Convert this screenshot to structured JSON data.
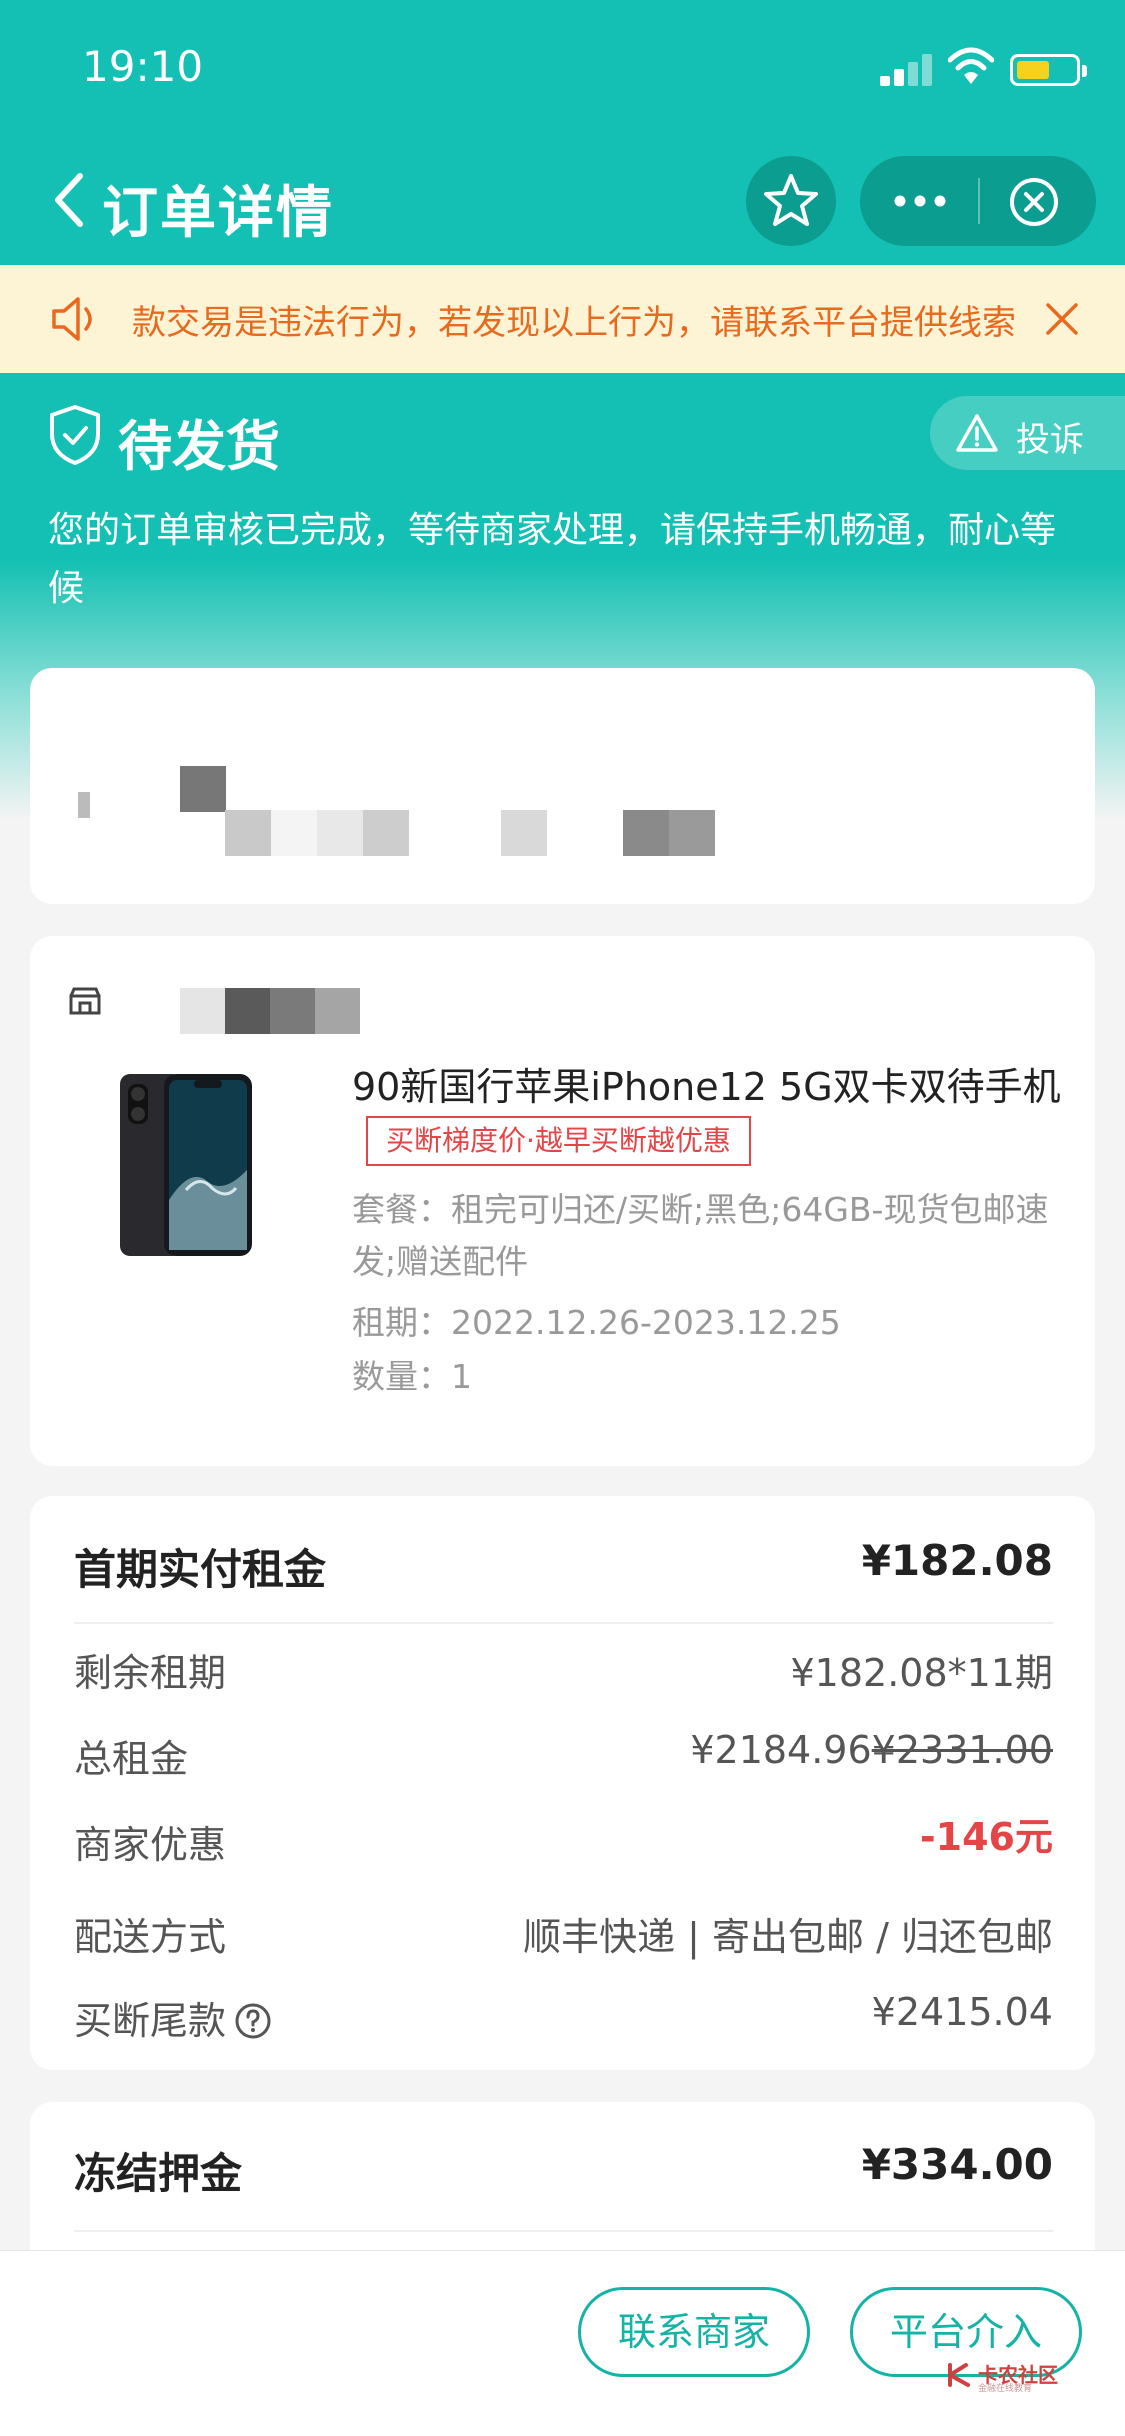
{
  "status_bar": {
    "time": "19:10"
  },
  "nav": {
    "title": "订单详情"
  },
  "notice": {
    "text": "款交易是违法行为，若发现以上行为，请联系平台提供线索"
  },
  "order_status": {
    "title": "待发货",
    "description": "您的订单审核已完成，等待商家处理，请保持手机畅通，耐心等候",
    "complain_label": "投诉"
  },
  "product": {
    "title": "90新国行苹果iPhone12 5G双卡双待手机",
    "promo_tag": "买断梯度价·越早买断越优惠",
    "spec": "套餐：租完可归还/买断;黑色;64GB-现货包邮速发;赠送配件",
    "term": "租期：2022.12.26-2023.12.25",
    "quantity": "数量：1"
  },
  "rent": {
    "first_label": "首期实付租金",
    "first_value": "¥182.08",
    "remaining_label": "剩余租期",
    "remaining_value": "¥182.08*11期",
    "total_label": "总租金",
    "total_value": "¥2184.96",
    "total_original": "¥2331.00",
    "discount_label": "商家优惠",
    "discount_value": "-146元",
    "delivery_label": "配送方式",
    "delivery_value": "顺丰快递 | 寄出包邮 / 归还包邮",
    "buyout_label": "买断尾款",
    "buyout_value": "¥2415.04"
  },
  "deposit": {
    "label": "冻结押金",
    "value": "¥334.00"
  },
  "actions": {
    "contact": "联系商家",
    "platform": "平台介入"
  },
  "watermark": {
    "text": "卡农社区",
    "sub": "金融在线教育"
  },
  "colors": {
    "brand": "#14c0b3",
    "accent_text": "#14b3a6",
    "warning": "#e86a1e",
    "danger": "#e54546"
  }
}
